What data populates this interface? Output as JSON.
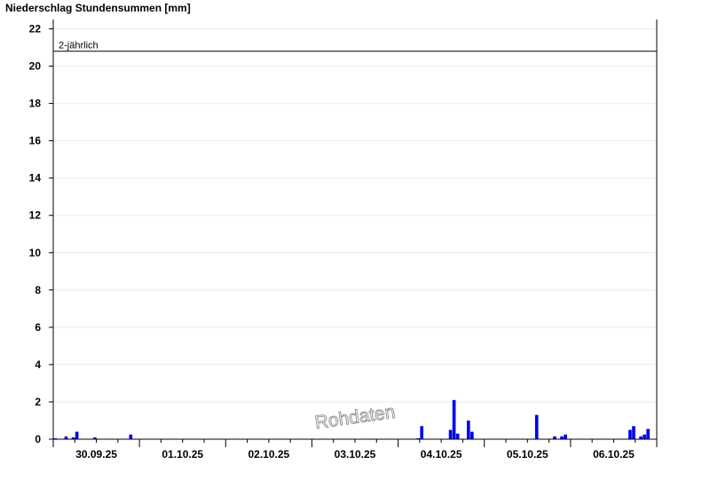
{
  "chart_data": {
    "type": "bar",
    "title": "Niederschlag Stundensummen [mm]",
    "xlabel": "",
    "ylabel": "",
    "ylim": [
      0,
      22.5
    ],
    "y_ticks": [
      0,
      2,
      4,
      6,
      8,
      10,
      12,
      14,
      16,
      18,
      20,
      22
    ],
    "x_range_hours": [
      0,
      168
    ],
    "x_tick_labels": [
      {
        "label": "30.09.25",
        "hour": 12
      },
      {
        "label": "01.10.25",
        "hour": 36
      },
      {
        "label": "02.10.25",
        "hour": 60
      },
      {
        "label": "03.10.25",
        "hour": 84
      },
      {
        "label": "04.10.25",
        "hour": 108
      },
      {
        "label": "05.10.25",
        "hour": 132
      },
      {
        "label": "06.10.25",
        "hour": 156
      }
    ],
    "x_minor_tick_hours": [
      0,
      6,
      12,
      18,
      24,
      30,
      36,
      42,
      48,
      54,
      60,
      66,
      72,
      78,
      84,
      90,
      96,
      102,
      108,
      114,
      120,
      126,
      132,
      138,
      144,
      150,
      156,
      162,
      168
    ],
    "grid": true,
    "bar_color": "#0000ee",
    "reference_line": {
      "label": "2-jährlich",
      "value": 20.8
    },
    "watermark": "Rohdaten",
    "series": [
      {
        "x_hours": [
          1,
          4,
          6,
          7,
          12,
          22,
          102,
          103,
          111,
          112,
          113,
          116,
          117,
          135,
          140,
          142,
          143,
          161,
          162,
          164,
          165,
          166
        ],
        "values": [
          0.05,
          0.15,
          0.1,
          0.4,
          0.1,
          0.25,
          0.05,
          0.7,
          0.5,
          2.1,
          0.3,
          1.0,
          0.4,
          1.3,
          0.15,
          0.15,
          0.25,
          0.5,
          0.7,
          0.15,
          0.25,
          0.55
        ]
      }
    ]
  }
}
